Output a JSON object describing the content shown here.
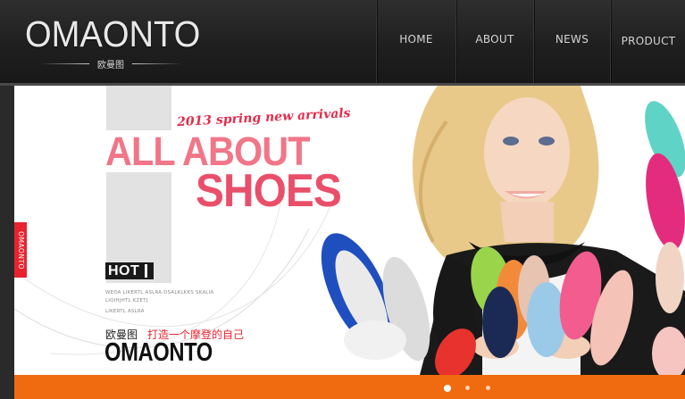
{
  "header": {
    "logo_text": "OMAONTO",
    "logo_subtext": "欧曼图"
  },
  "nav": {
    "items": [
      {
        "label": "HOME"
      },
      {
        "label": "ABOUT"
      },
      {
        "label": "NEWS"
      },
      {
        "label": "PRODUCT"
      }
    ]
  },
  "side_tab": {
    "label": "OMAONTO"
  },
  "banner": {
    "script_title": "2013 spring new arrivals",
    "headline_line1": "ALL ABOUT",
    "headline_line2": "SHOES",
    "hot_badge": "HOT",
    "fine_print": [
      "WEDA LIKERTL  ASLRA  DSALKLKKS SKALIA",
      "LIQIHJHTL KZETJ",
      "",
      "LIKERTL  ASLRA"
    ],
    "cn_brand": "欧曼图",
    "cn_slogan": "打造一个摩登的自己",
    "brand_big": "OMAONTO"
  },
  "slider": {
    "dots": 3,
    "active_index": 0
  },
  "colors": {
    "accent_red": "#e8232e",
    "headline_pink": "#f07688",
    "orange_bar": "#f06a10",
    "header_bg": "#1f1f1f"
  }
}
